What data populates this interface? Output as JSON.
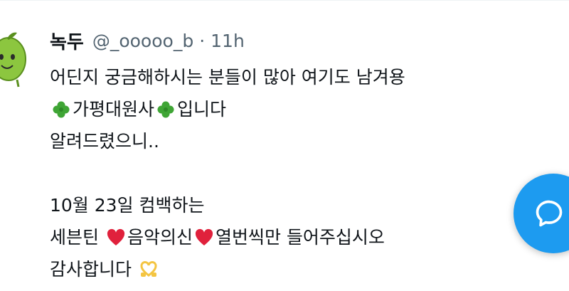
{
  "tweet": {
    "author": {
      "display_name": "녹두",
      "handle": "@_ooooo_b",
      "separator": "·",
      "time": "11h"
    },
    "lines": [
      {
        "parts": [
          {
            "text": "어딘지 궁금해하시는 분들이 많아 여기도 남겨용"
          }
        ]
      },
      {
        "parts": [
          {
            "emoji": "clover-icon"
          },
          {
            "text": "가평대원사"
          },
          {
            "emoji": "clover-icon"
          },
          {
            "text": "입니다"
          }
        ]
      },
      {
        "parts": [
          {
            "text": "알려드렸으니.."
          }
        ]
      },
      {
        "parts": []
      },
      {
        "parts": [
          {
            "text": "10월 23일 컴백하는"
          }
        ]
      },
      {
        "parts": [
          {
            "text": "세븐틴 "
          },
          {
            "emoji": "red-heart-icon"
          },
          {
            "text": "음악의신"
          },
          {
            "emoji": "red-heart-icon"
          },
          {
            "text": "열번씩만 들어주십시오"
          }
        ]
      },
      {
        "parts": [
          {
            "text": "감사합니다 "
          },
          {
            "emoji": "heart-hands-icon"
          }
        ]
      }
    ]
  },
  "fab": {
    "icon": "chat-bubble-icon",
    "color": "#1d9bf0"
  },
  "colors": {
    "text": "#0f1419",
    "secondary": "#536471",
    "accent": "#1d9bf0"
  }
}
